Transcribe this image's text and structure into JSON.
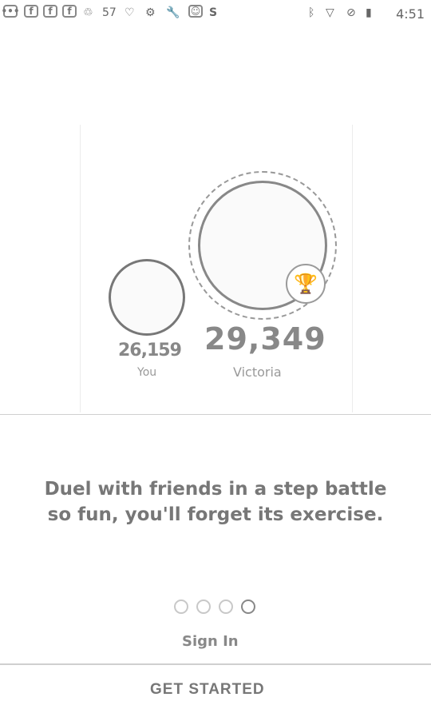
{
  "status_bar": {
    "time": "4:51",
    "notif_count": "57",
    "icons_left": [
      "chat-icon",
      "facebook-icon",
      "facebook-icon",
      "facebook-icon",
      "app-icon",
      "badge-icon",
      "heart-icon",
      "app-icon",
      "wrench-icon",
      "smiley-icon",
      "skype-icon"
    ],
    "icons_right": [
      "bluetooth-icon",
      "wifi-icon",
      "no-sim-icon",
      "battery-icon"
    ]
  },
  "hero": {
    "you_score": "26,159",
    "you_label": "You",
    "opponent_score": "29,349",
    "opponent_label": "Victoria",
    "trophy_icon": "trophy-icon"
  },
  "caption": {
    "line1": "Duel with friends in a step battle",
    "line2": "so fun, you'll forget its exercise."
  },
  "pager": {
    "count": 4,
    "active_index": 3
  },
  "actions": {
    "signin_label": "Sign In",
    "get_started_label": "GET STARTED"
  }
}
